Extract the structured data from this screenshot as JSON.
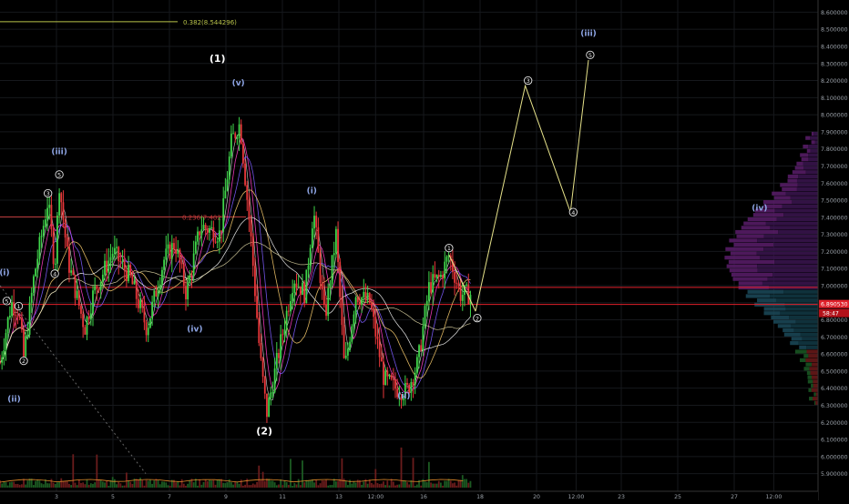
{
  "chart_data": {
    "type": "candlestick",
    "instrument_price_axis": {
      "ylim": [
        5.85,
        8.65
      ],
      "tick_labels": [
        "8.600000",
        "8.500000",
        "8.400000",
        "8.300000",
        "8.200000",
        "8.100000",
        "8.000000",
        "7.900000",
        "7.800000",
        "7.700000",
        "7.600000",
        "7.500000",
        "7.400000",
        "7.300000",
        "7.200000",
        "7.100000",
        "7.000000",
        "6.900000",
        "6.800000",
        "6.700000",
        "6.600000",
        "6.500000",
        "6.400000",
        "6.300000",
        "6.200000",
        "6.100000",
        "6.000000",
        "5.900000"
      ],
      "tick_values": [
        8.6,
        8.5,
        8.4,
        8.3,
        8.2,
        8.1,
        8.0,
        7.9,
        7.8,
        7.7,
        7.6,
        7.5,
        7.4,
        7.3,
        7.2,
        7.1,
        7.0,
        6.9,
        6.8,
        6.7,
        6.6,
        6.5,
        6.4,
        6.3,
        6.2,
        6.1,
        6.0,
        5.9
      ]
    },
    "time_axis": {
      "xlim": [
        0,
        30
      ],
      "ticks": [
        {
          "label": "3",
          "t": 1
        },
        {
          "label": "5",
          "t": 2
        },
        {
          "label": "7",
          "t": 3
        },
        {
          "label": "9",
          "t": 4
        },
        {
          "label": "11",
          "t": 5
        },
        {
          "label": "13",
          "t": 6
        },
        {
          "label": "12:00",
          "t": 6.65
        },
        {
          "label": "16",
          "t": 7.5
        },
        {
          "label": "18",
          "t": 8.5
        },
        {
          "label": "20",
          "t": 9.5
        },
        {
          "label": "12:00",
          "t": 10.2
        },
        {
          "label": "23",
          "t": 11
        },
        {
          "label": "25",
          "t": 12
        },
        {
          "label": "27",
          "t": 13
        },
        {
          "label": "12:00",
          "t": 13.7
        }
      ]
    },
    "current_price_label": "6.890530",
    "countdown_label": "58:47",
    "fib_levels": [
      {
        "label": "0.382(8.544296)",
        "value": 8.544296,
        "color": "#b8c24a"
      },
      {
        "label": "0.236(7.4027",
        "value": 7.4027,
        "color": "#c23a3a"
      }
    ],
    "horizontal_lines": [
      {
        "value": 6.99,
        "color": "#e0202a"
      },
      {
        "value": 6.89,
        "color": "#e0202a"
      }
    ],
    "projection_path": [
      {
        "t": 8.42,
        "price": 6.85
      },
      {
        "t": 9.3,
        "price": 8.17
      },
      {
        "t": 10.1,
        "price": 7.43
      },
      {
        "t": 10.42,
        "price": 8.32
      }
    ],
    "wave_labels": [
      {
        "text": "(1)",
        "t": 3.85,
        "price": 8.31,
        "color": "#ffffff",
        "size": 11
      },
      {
        "text": "(v)",
        "t": 4.22,
        "price": 8.17,
        "color": "#8fa6e6",
        "size": 9
      },
      {
        "text": "(iii)",
        "t": 1.05,
        "price": 7.77,
        "color": "#8fa6e6",
        "size": 9
      },
      {
        "text": "(i)",
        "t": 0.08,
        "price": 7.06,
        "color": "#8fa6e6",
        "size": 9
      },
      {
        "text": "(ii)",
        "t": 0.25,
        "price": 6.32,
        "color": "#8fa6e6",
        "size": 9
      },
      {
        "text": "(iv)",
        "t": 3.45,
        "price": 6.73,
        "color": "#8fa6e6",
        "size": 9
      },
      {
        "text": "(i)",
        "t": 5.52,
        "price": 7.54,
        "color": "#8fa6e6",
        "size": 9
      },
      {
        "text": "(2)",
        "t": 4.68,
        "price": 6.13,
        "color": "#ffffff",
        "size": 11
      },
      {
        "text": "(ii)",
        "t": 7.15,
        "price": 6.34,
        "color": "#8fa6e6",
        "size": 9
      },
      {
        "text": "(iii)",
        "t": 10.42,
        "price": 8.46,
        "color": "#8fa6e6",
        "size": 9
      },
      {
        "text": "(iv)",
        "t": 13.45,
        "price": 7.44,
        "color": "#8fa6e6",
        "size": 9
      }
    ],
    "circled_labels": [
      {
        "text": "1",
        "t": 0.33,
        "price": 6.88
      },
      {
        "text": "2",
        "t": 0.42,
        "price": 6.56
      },
      {
        "text": "3",
        "t": 0.85,
        "price": 7.54
      },
      {
        "text": "4",
        "t": 0.97,
        "price": 7.07
      },
      {
        "text": "5",
        "t": 1.05,
        "price": 7.65
      },
      {
        "text": "5",
        "t": 0.12,
        "price": 6.91
      },
      {
        "text": "1",
        "t": 7.95,
        "price": 7.22
      },
      {
        "text": "2",
        "t": 8.45,
        "price": 6.81
      },
      {
        "text": "3",
        "t": 9.35,
        "price": 8.2
      },
      {
        "text": "4",
        "t": 10.15,
        "price": 7.43
      },
      {
        "text": "5",
        "t": 10.45,
        "price": 8.35
      }
    ],
    "volume_profile": {
      "price_from": 6.3,
      "price_to": 7.9
    }
  }
}
